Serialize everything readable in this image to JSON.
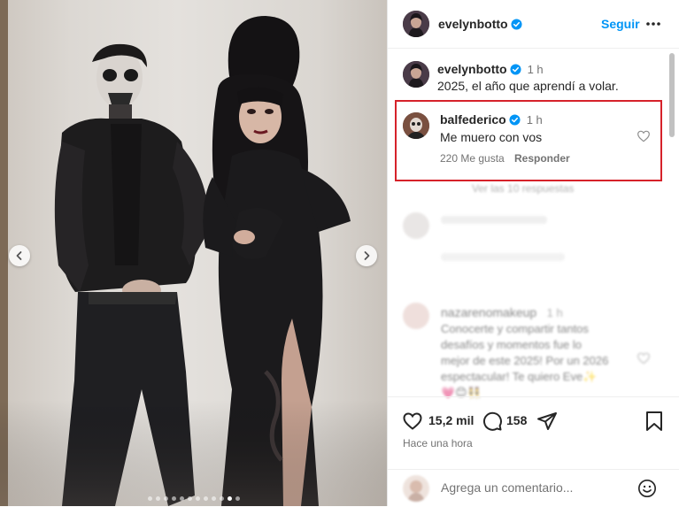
{
  "post": {
    "username": "evelynbotto",
    "follow_label": "Seguir",
    "caption": {
      "username": "evelynbotto",
      "time": "1 h",
      "text": "2025, el año que aprendí a volar."
    },
    "highlighted_comment": {
      "username": "balfederico",
      "time": "1 h",
      "text": "Me muero con vos",
      "likes": "220 Me gusta",
      "reply_label": "Responder"
    },
    "faded_comments": {
      "view_replies": "Ver las 10 respuestas",
      "comment": {
        "username": "nazarenomakeup",
        "time": "1 h",
        "lines": [
          "Conocerte y compartir tantos",
          "desafíos y momentos fue lo",
          "mejor de este 2025! Por un 2026",
          "espectacular! Te quiero Eve✨",
          "💗😊👯"
        ]
      }
    },
    "stats": {
      "likes": "15,2 mil",
      "comments": "158",
      "posted": "Hace una hora"
    },
    "add_comment_placeholder": "Agrega un comentario...",
    "carousel": {
      "slide_count": 12,
      "active_index": 10
    }
  },
  "colors": {
    "accent": "#0095f6",
    "verified": "#0095f6",
    "highlight_border": "#d6222a",
    "text": "#262626",
    "muted": "#737373"
  },
  "icons": [
    "verified-icon",
    "more-icon",
    "heart-icon",
    "comment-icon",
    "share-icon",
    "save-icon",
    "emoji-icon",
    "chevron-left-icon",
    "chevron-right-icon"
  ]
}
